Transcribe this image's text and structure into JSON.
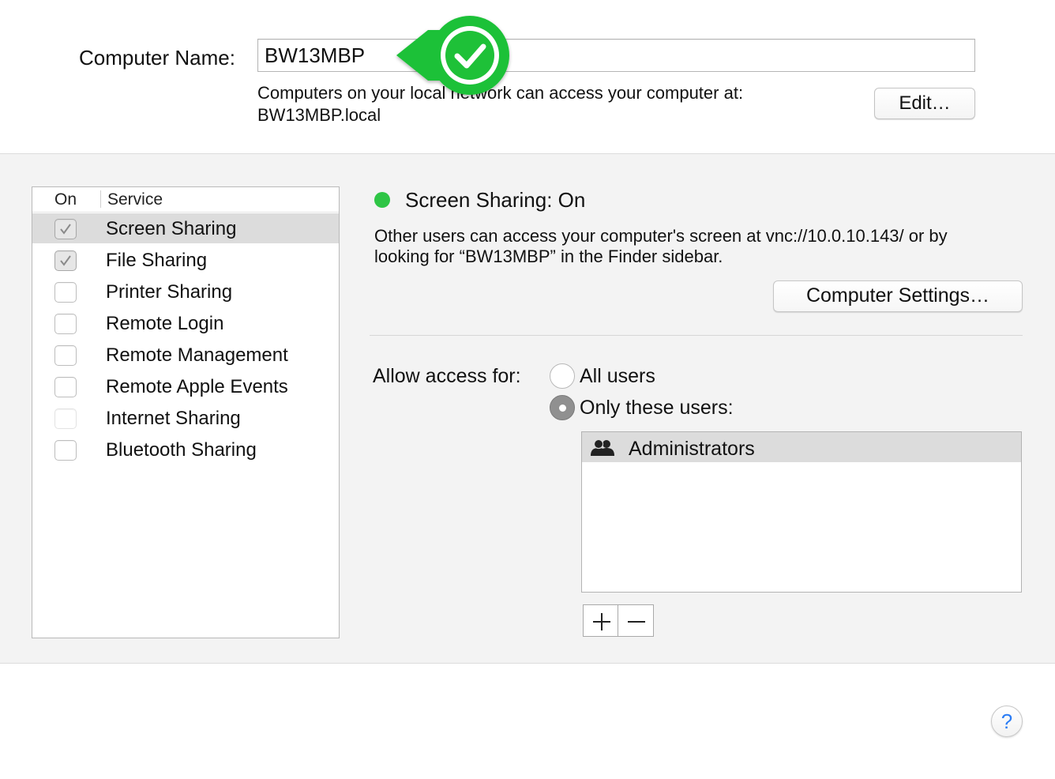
{
  "computer_name": {
    "label": "Computer Name:",
    "value": "BW13MBP",
    "help_line1": "Computers on your local network can access your computer at:",
    "help_line2": "BW13MBP.local",
    "edit_button": "Edit…"
  },
  "badge": {
    "icon": "checkmark-icon",
    "color": "#1ec138"
  },
  "services": {
    "header_on": "On",
    "header_service": "Service",
    "items": [
      {
        "label": "Screen Sharing",
        "checked": true,
        "selected": true,
        "enabled": true
      },
      {
        "label": "File Sharing",
        "checked": true,
        "selected": false,
        "enabled": true
      },
      {
        "label": "Printer Sharing",
        "checked": false,
        "selected": false,
        "enabled": true
      },
      {
        "label": "Remote Login",
        "checked": false,
        "selected": false,
        "enabled": true
      },
      {
        "label": "Remote Management",
        "checked": false,
        "selected": false,
        "enabled": true
      },
      {
        "label": "Remote Apple Events",
        "checked": false,
        "selected": false,
        "enabled": true
      },
      {
        "label": "Internet Sharing",
        "checked": false,
        "selected": false,
        "enabled": false
      },
      {
        "label": "Bluetooth Sharing",
        "checked": false,
        "selected": false,
        "enabled": true
      }
    ]
  },
  "detail": {
    "status_title": "Screen Sharing: On",
    "status_color": "#2ec545",
    "description_line1": "Other users can access your computer's screen at vnc://10.0.10.143/ or by",
    "description_line2": "looking for “BW13MBP” in the Finder sidebar.",
    "settings_button": "Computer Settings…",
    "allow_label": "Allow access for:",
    "option_all": "All users",
    "option_only": "Only these users:",
    "selected_option": "only",
    "users": [
      {
        "label": "Administrators",
        "icon": "group-icon"
      }
    ],
    "add_button_icon": "plus-icon",
    "remove_button_icon": "minus-icon"
  },
  "help_button": "?"
}
